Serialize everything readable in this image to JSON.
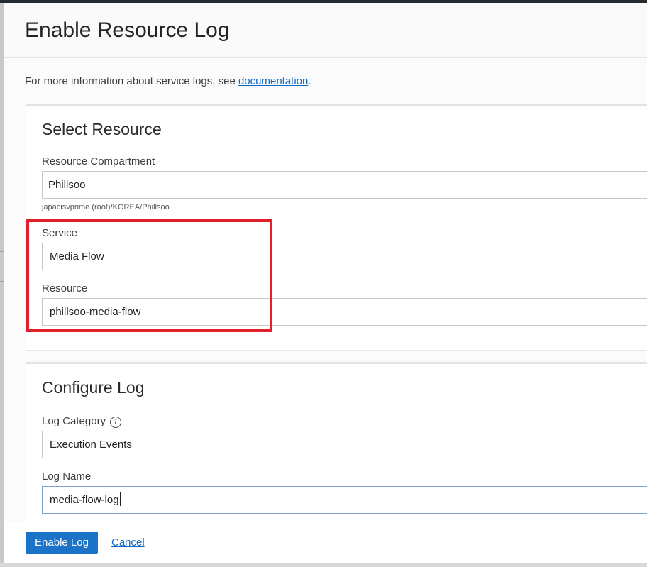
{
  "dialog": {
    "title": "Enable Resource Log",
    "info_prefix": "For more information about service logs, see ",
    "info_link": "documentation",
    "info_suffix": "."
  },
  "select_resource": {
    "title": "Select Resource",
    "compartment_label": "Resource Compartment",
    "compartment_value": "Phillsoo",
    "compartment_path": "japacisvprime (root)/KOREA/Phillsoo",
    "service_label": "Service",
    "service_value": "Media Flow",
    "resource_label": "Resource",
    "resource_value": "phillsoo-media-flow"
  },
  "configure_log": {
    "title": "Configure Log",
    "category_label": "Log Category",
    "category_value": "Execution Events",
    "name_label": "Log Name",
    "name_value": "media-flow-log"
  },
  "footer": {
    "enable_label": "Enable Log",
    "cancel_label": "Cancel"
  },
  "icons": {
    "info": "info-icon"
  },
  "colors": {
    "primary": "#1b73c8",
    "link": "#0f69c5",
    "highlight": "#e0202a"
  }
}
